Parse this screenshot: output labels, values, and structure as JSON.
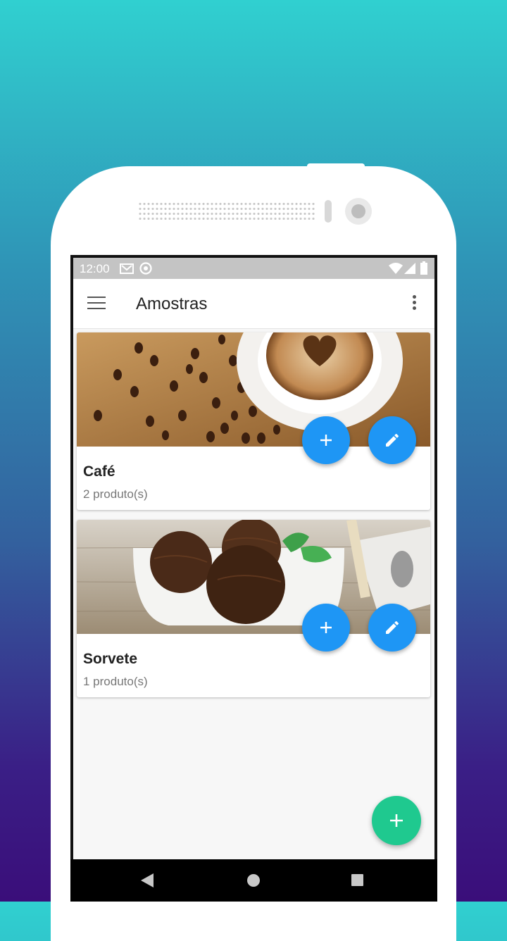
{
  "status_bar": {
    "time": "12:00"
  },
  "app_bar": {
    "title": "Amostras"
  },
  "cards": [
    {
      "title": "Café",
      "subtitle": "2 produto(s)"
    },
    {
      "title": "Sorvete",
      "subtitle": "1 produto(s)"
    }
  ],
  "icons": {
    "menu": "menu-icon",
    "more": "more-vert-icon",
    "add": "add-icon",
    "edit": "pencil-icon",
    "back": "back-icon",
    "home": "home-icon",
    "recents": "recents-icon"
  },
  "colors": {
    "mini_fab": "#1e96f5",
    "main_fab": "#1fc98f",
    "app_bar": "#ffffff",
    "status_bar": "#c4c4c4"
  }
}
